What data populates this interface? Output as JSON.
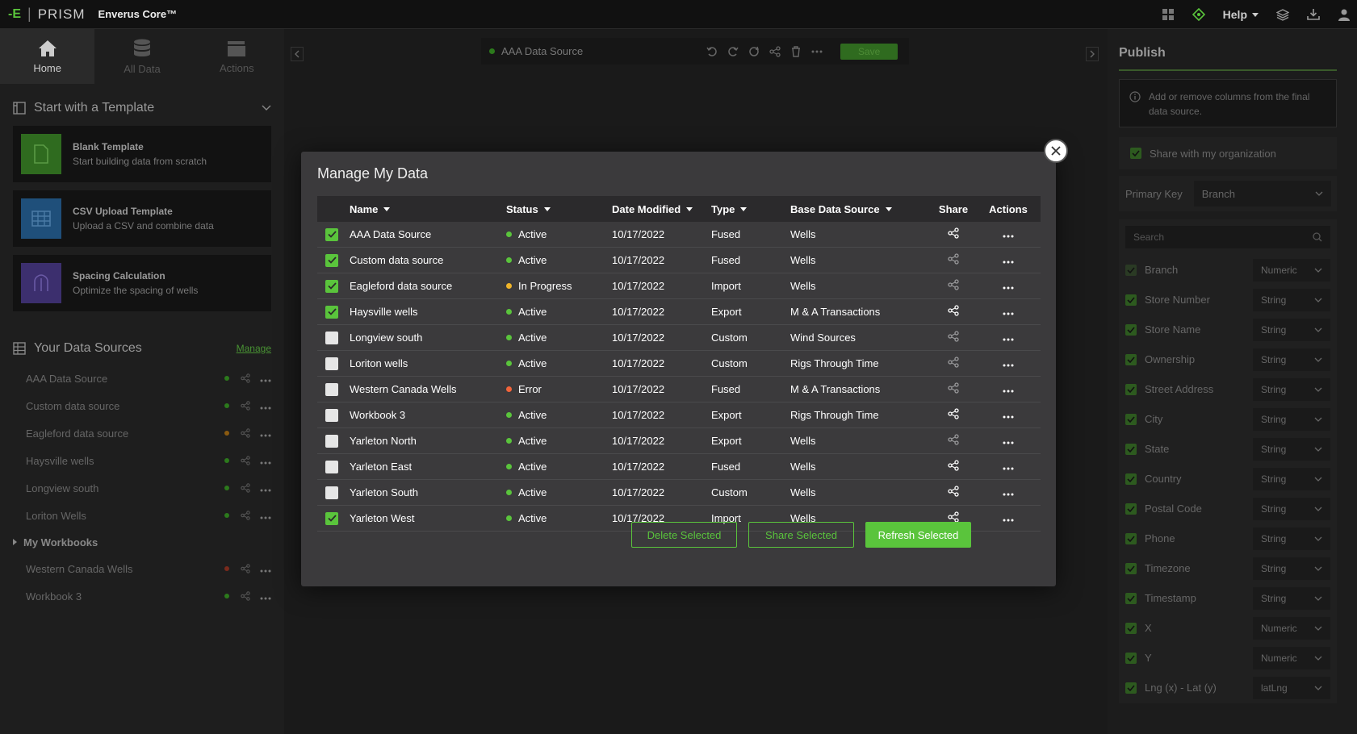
{
  "topbar": {
    "logo_mark": "-E",
    "logo_sep": "|",
    "logo_text": "PRISM",
    "product": "Enverus Core™",
    "help": "Help"
  },
  "left": {
    "nav": [
      {
        "label": "Home",
        "icon": "home-icon"
      },
      {
        "label": "All Data",
        "icon": "database-icon"
      },
      {
        "label": "Actions",
        "icon": "clapper-icon"
      }
    ],
    "template_header": "Start with a Template",
    "templates": [
      {
        "title": "Blank Template",
        "subtitle": "Start building data from scratch",
        "color": "#2f6b1f"
      },
      {
        "title": "CSV Upload Template",
        "subtitle": "Upload a CSV and combine data",
        "color": "#1f4f7a"
      },
      {
        "title": "Spacing Calculation",
        "subtitle": "Optimize the spacing of wells",
        "color": "#3c2f6e"
      }
    ],
    "sources_header": "Your Data Sources",
    "manage": "Manage",
    "sources": [
      {
        "name": "AAA Data Source",
        "status_color": "#2c7a1c"
      },
      {
        "name": "Custom data source",
        "status_color": "#2c7a1c"
      },
      {
        "name": "Eagleford data source",
        "status_color": "#8a5a10"
      },
      {
        "name": "Haysville wells",
        "status_color": "#2c7a1c"
      },
      {
        "name": "Longview south",
        "status_color": "#2c7a1c"
      },
      {
        "name": "Loriton Wells",
        "status_color": "#2c7a1c"
      }
    ],
    "workbooks_header": "My Workbooks",
    "workbooks": [
      {
        "name": "Western Canada Wells",
        "status_color": "#7a2a1c"
      },
      {
        "name": "Workbook 3",
        "status_color": "#2c7a1c"
      }
    ]
  },
  "toolbar": {
    "source_name": "AAA Data Source",
    "save_label": "Save"
  },
  "publish": {
    "title": "Publish",
    "info": "Add or remove columns from the final data source.",
    "share_org": "Share with my organization",
    "primary_key_label": "Primary Key",
    "primary_key_value": "Branch",
    "search_placeholder": "Search",
    "columns": [
      {
        "name": "Branch",
        "type": "Numeric",
        "dim": true
      },
      {
        "name": "Store Number",
        "type": "String"
      },
      {
        "name": "Store Name",
        "type": "String"
      },
      {
        "name": "Ownership",
        "type": "String"
      },
      {
        "name": "Street Address",
        "type": "String"
      },
      {
        "name": "City",
        "type": "String"
      },
      {
        "name": "State",
        "type": "String"
      },
      {
        "name": "Country",
        "type": "String"
      },
      {
        "name": "Postal Code",
        "type": "String"
      },
      {
        "name": "Phone",
        "type": "String"
      },
      {
        "name": "Timezone",
        "type": "String"
      },
      {
        "name": "Timestamp",
        "type": "String"
      },
      {
        "name": "X",
        "type": "Numeric"
      },
      {
        "name": "Y",
        "type": "Numeric"
      },
      {
        "name": "Lng (x) - Lat (y)",
        "type": "latLng"
      }
    ]
  },
  "modal": {
    "title": "Manage My Data",
    "headers": {
      "name": "Name",
      "status": "Status",
      "date": "Date Modified",
      "type": "Type",
      "base": "Base Data Source",
      "share": "Share",
      "actions": "Actions"
    },
    "rows": [
      {
        "checked": true,
        "name": "AAA Data Source",
        "status": "Active",
        "status_color": "#5ac43c",
        "date": "10/17/2022",
        "type": "Fused",
        "base": "Wells",
        "shared": true
      },
      {
        "checked": true,
        "name": "Custom data source",
        "status": "Active",
        "status_color": "#5ac43c",
        "date": "10/17/2022",
        "type": "Fused",
        "base": "Wells",
        "shared": false
      },
      {
        "checked": true,
        "name": "Eagleford data source",
        "status": "In Progress",
        "status_color": "#f0b429",
        "date": "10/17/2022",
        "type": "Import",
        "base": "Wells",
        "shared": false
      },
      {
        "checked": true,
        "name": "Haysville wells",
        "status": "Active",
        "status_color": "#5ac43c",
        "date": "10/17/2022",
        "type": "Export",
        "base": "M & A Transactions",
        "shared": true
      },
      {
        "checked": false,
        "name": "Longview south",
        "status": "Active",
        "status_color": "#5ac43c",
        "date": "10/17/2022",
        "type": "Custom",
        "base": "Wind Sources",
        "shared": false
      },
      {
        "checked": false,
        "name": "Loriton wells",
        "status": "Active",
        "status_color": "#5ac43c",
        "date": "10/17/2022",
        "type": "Custom",
        "base": "Rigs Through Time",
        "shared": false
      },
      {
        "checked": false,
        "name": "Western Canada Wells",
        "status": "Error",
        "status_color": "#f2643a",
        "date": "10/17/2022",
        "type": "Fused",
        "base": "M & A Transactions",
        "shared": false
      },
      {
        "checked": false,
        "name": "Workbook 3",
        "status": "Active",
        "status_color": "#5ac43c",
        "date": "10/17/2022",
        "type": "Export",
        "base": "Rigs Through Time",
        "shared": true
      },
      {
        "checked": false,
        "name": "Yarleton North",
        "status": "Active",
        "status_color": "#5ac43c",
        "date": "10/17/2022",
        "type": "Export",
        "base": "Wells",
        "shared": false
      },
      {
        "checked": false,
        "name": "Yarleton East",
        "status": "Active",
        "status_color": "#5ac43c",
        "date": "10/17/2022",
        "type": "Fused",
        "base": "Wells",
        "shared": true
      },
      {
        "checked": false,
        "name": "Yarleton South",
        "status": "Active",
        "status_color": "#5ac43c",
        "date": "10/17/2022",
        "type": "Custom",
        "base": "Wells",
        "shared": true
      },
      {
        "checked": true,
        "name": "Yarleton West",
        "status": "Active",
        "status_color": "#5ac43c",
        "date": "10/17/2022",
        "type": "Import",
        "base": "Wells",
        "shared": true
      }
    ],
    "buttons": {
      "delete": "Delete Selected",
      "share": "Share Selected",
      "refresh": "Refresh Selected"
    }
  },
  "colors": {
    "accent": "#5ac43c",
    "modal_bg": "#3b3a3c",
    "header_bg": "#2b2a2c"
  }
}
